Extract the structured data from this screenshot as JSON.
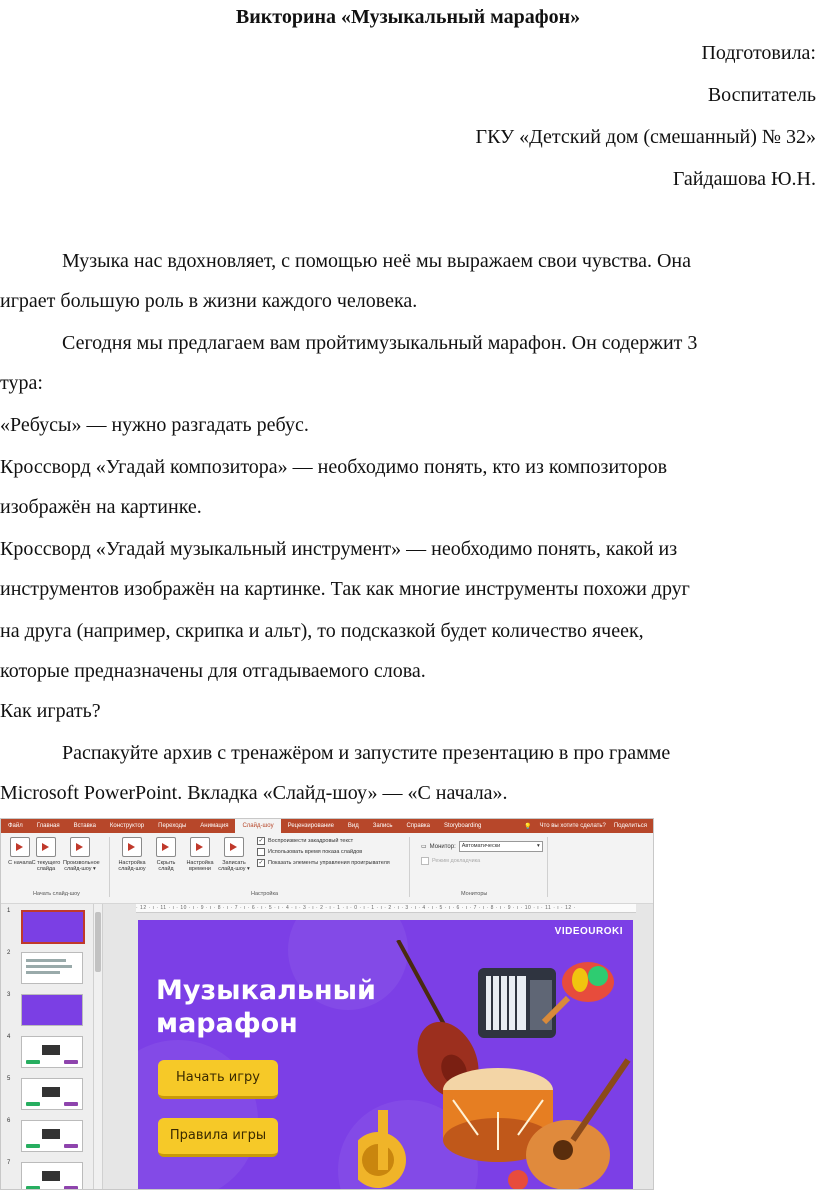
{
  "document": {
    "title": "Викторина «Музыкальный марафон»",
    "author_block": [
      "Подготовила:",
      "Воспитатель",
      "ГКУ «Детский дом (смешанный) № 32»",
      "Гайдашова Ю.Н."
    ],
    "lines": [
      "Музыка нас вдохновляет, с помощью неё мы выражаем свои чувства. Она",
      "играет большую роль в жизни каждого человека.",
      "Сегодня мы предлагаем вам пройтимузыкальный марафон. Он содержит 3",
      "тура:",
      "«Ребусы» — нужно разгадать ребус.",
      "Кроссворд  «Угадай композитора»  —  необходимо понять, кто из композиторов",
      "изображён на картинке.",
      "Кроссворд «Угадай музыкальный инструмент» — необходимо понять, какой из",
      "инструментов изображён на картинке. Так как многие инструменты похожи друг",
      "на друга (например, скрипка и альт), то подсказкой будет количество ячеек,",
      "которые предназначены для отгадываемого слова.",
      "Как играть?",
      "Распакуйте архив с тренажёром и запустите презентацию в про        грамме",
      "Microsoft PowerPoint. Вкладка «Слайд-шоу» — «С начала»."
    ]
  },
  "screenshot": {
    "menu_tabs": [
      "Файл",
      "Главная",
      "Вставка",
      "Конструктор",
      "Переходы",
      "Анимация",
      "Слайд-шоу",
      "Рецензирование",
      "Вид",
      "Запись",
      "Справка",
      "Storyboarding"
    ],
    "active_tab": "Слайд-шоу",
    "tell_me": "Что вы хотите сделать?",
    "share": "Поделиться",
    "ribbon_buttons": [
      {
        "label": "С начала"
      },
      {
        "label": "С текущего слайда"
      },
      {
        "label": "Произвольное слайд-шоу ▾"
      },
      {
        "label": "Настройка слайд-шоу"
      },
      {
        "label": "Скрыть слайд"
      },
      {
        "label": "Настройка времени"
      },
      {
        "label": "Записать слайд-шоу ▾"
      }
    ],
    "checkboxes": [
      {
        "label": "Воспроизвести закадровый текст",
        "checked": true
      },
      {
        "label": "Использовать время показа слайдов",
        "checked": false
      },
      {
        "label": "Показать элементы управления проигрывателя",
        "checked": true
      }
    ],
    "groups": [
      "Начать слайд-шоу",
      "Настройка",
      "Мониторы"
    ],
    "monitor_label": "Монитор:",
    "monitor_value": "Автоматически",
    "presenter_mode": "Режим докладчика",
    "ruler_text": "· 12 · ı · 11 · ı · 10 · ı · 9 · ı · 8 · ı · 7 · ı · 6 · ı · 5 · ı · 4 · ı · 3 · ı · 2 · ı · 1 · ı · 0 · ı · 1 · ı · 2 · ı · 3 · ı · 4 · ı · 5 · ı · 6 · ı · 7 · ı · 8 · ı · 9 · ı · 10 · ı · 11 · ı · 12 ·",
    "thumbnails": [
      "1",
      "2",
      "3",
      "4",
      "5",
      "6",
      "7"
    ],
    "slide": {
      "brand": "VIDEOUROKI",
      "title_line1": "Музыкальный",
      "title_line2": "марафон",
      "start_button": "Начать игру",
      "rules_button": "Правила игры"
    }
  }
}
